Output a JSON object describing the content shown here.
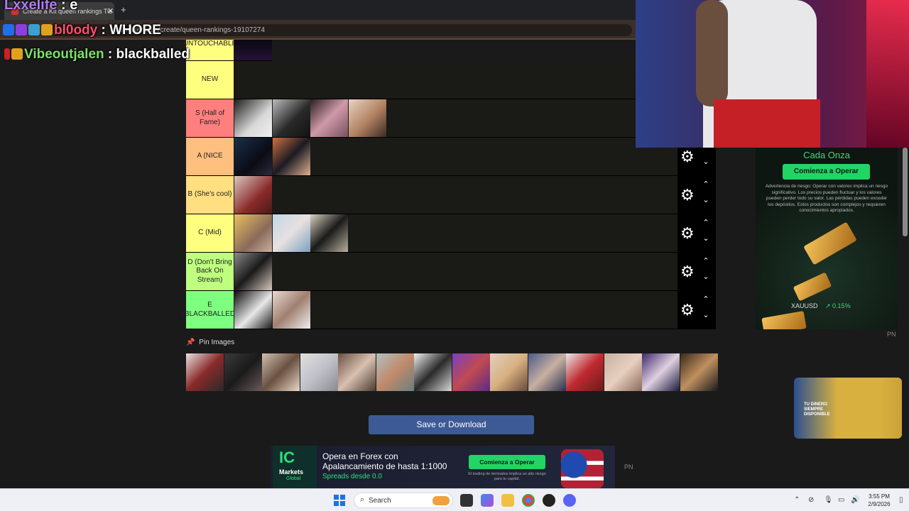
{
  "browser": {
    "tab_title": "Create a Kit queen rankings Tie",
    "new_tab": "+",
    "tab_close": "✕",
    "url": "tiermaker.com/create/queen-rankings-19107274"
  },
  "tiers": [
    {
      "label": "UNTOUCHABLE",
      "color": "#ffff7f",
      "images": 1
    },
    {
      "label": "NEW",
      "color": "#ffff7f",
      "images": 0
    },
    {
      "label": "S (Hall of Fame)",
      "color": "#ff7f7f",
      "images": 4
    },
    {
      "label": "A (NICE",
      "color": "#ffbf7f",
      "images": 2
    },
    {
      "label": "B (She's cool)",
      "color": "#ffdf7f",
      "images": 1
    },
    {
      "label": "C (Mid)",
      "color": "#ffff7f",
      "images": 3
    },
    {
      "label": "D (Don't Bring Back On Stream)",
      "color": "#bfff7f",
      "images": 1
    },
    {
      "label": "E (BLACKBALLED)",
      "color": "#7fff7f",
      "images": 2
    }
  ],
  "pin_images": {
    "label": "Pin Images",
    "count": 14
  },
  "save_button": "Save or Download",
  "chat": [
    {
      "user": "Lxxelife",
      "sep": " : ",
      "message": "e",
      "user_color": "#b07cf0"
    },
    {
      "user": "bl0ody",
      "sep": " : ",
      "message": "WHORE",
      "user_color": "#ff4d6d"
    },
    {
      "user": "Vibeoutjalen",
      "sep": " : ",
      "message": "blackballed",
      "user_color": "#7ee06a"
    }
  ],
  "ad_right": {
    "title": "Cada Onza",
    "cta": "Comienza a Operar",
    "disclaimer": "Advertencia de riesgo: Operar con valores implica un riesgo significativo. Los precios pueden fluctuar y los valores pueden perder todo su valor. Las pérdidas pueden exceder los depósitos. Estos productos son complejos y requieren conocimientos apropiados.",
    "ticker": "XAUUSD",
    "change": "0.15%"
  },
  "video_ad": {
    "text_line1": "TU DINERO",
    "text_line2": "SIEMPRE",
    "text_line3": "DISPONIBLE"
  },
  "pn_label": "PN",
  "bottom_ad": {
    "logo_big": "IC",
    "logo_markets": "Markets",
    "logo_global": "Global",
    "line1": "Opera en Forex con",
    "line2": "Apalancamiento de hasta 1:1000",
    "line3": "Spreads desde 0.0",
    "cta": "Comienza a Operar",
    "fine": "El trading de derivados implica un alto riesgo para tu capital."
  },
  "taskbar": {
    "search": "Search",
    "time": "3:55 PM",
    "date": "2/9/2026"
  }
}
